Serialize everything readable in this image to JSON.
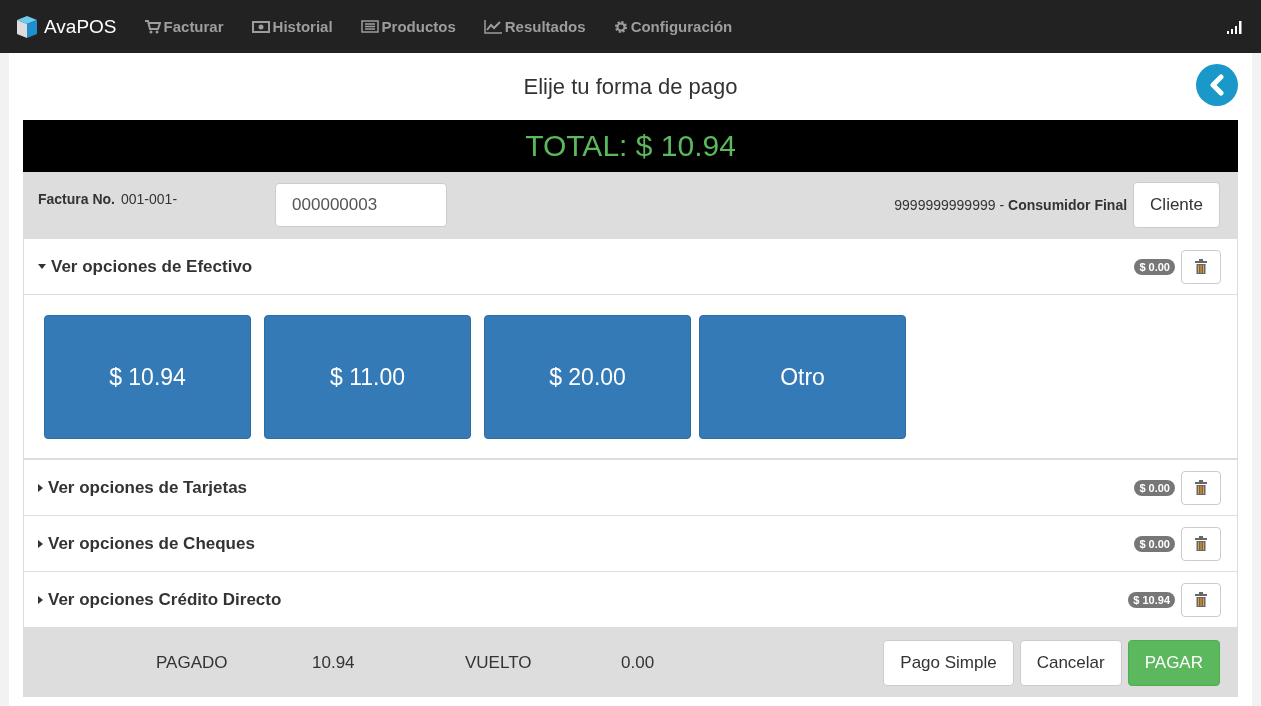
{
  "navbar": {
    "brand": "AvaPOS",
    "items": [
      {
        "label": "Facturar"
      },
      {
        "label": "Historial"
      },
      {
        "label": "Productos"
      },
      {
        "label": "Resultados"
      },
      {
        "label": "Configuración"
      }
    ]
  },
  "title": "Elije tu forma de pago",
  "total": "TOTAL: $ 10.94",
  "invoice": {
    "label": "Factura No.",
    "prefix": "001-001-",
    "number": "000000003",
    "client_id": "9999999999999 -",
    "client_name": "Consumidor Final",
    "client_button": "Cliente"
  },
  "sections": [
    {
      "title": "Ver opciones de Efectivo",
      "amount": "$ 0.00",
      "expanded": true,
      "options": [
        "$ 10.94",
        "$ 11.00",
        "$ 20.00",
        "Otro"
      ]
    },
    {
      "title": "Ver opciones de Tarjetas",
      "amount": "$ 0.00",
      "expanded": false
    },
    {
      "title": "Ver opciones de Cheques",
      "amount": "$ 0.00",
      "expanded": false
    },
    {
      "title": "Ver opciones Crédito Directo",
      "amount": "$ 10.94",
      "expanded": false
    }
  ],
  "footer": {
    "paid_label": "PAGADO",
    "paid": "10.94",
    "change_label": "VUELTO",
    "change": "0.00",
    "buttons": [
      {
        "label": "Pago Simple",
        "kind": "default"
      },
      {
        "label": "Cancelar",
        "kind": "default"
      },
      {
        "label": "PAGAR",
        "kind": "success"
      }
    ]
  }
}
